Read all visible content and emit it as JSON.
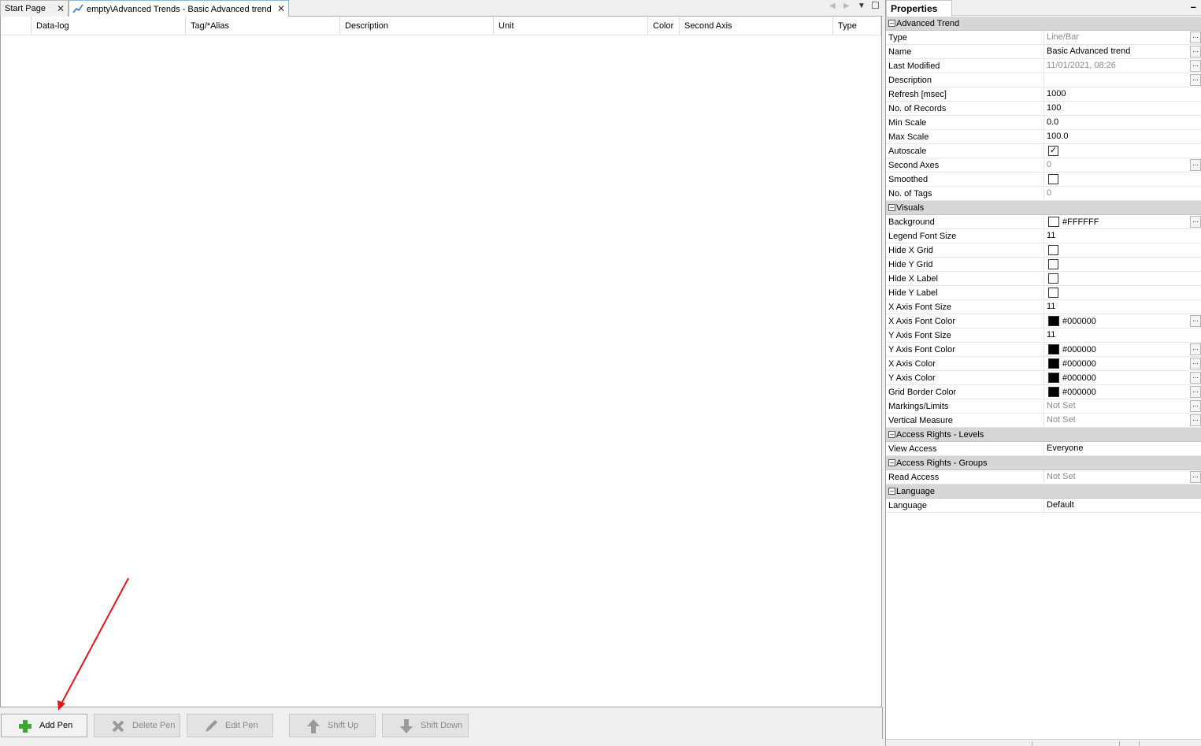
{
  "tabs": [
    {
      "label": "Start Page"
    },
    {
      "label": "empty\\Advanced Trends - Basic Advanced trend"
    }
  ],
  "grid": {
    "columns": [
      "Data-log",
      "Tag/*Alias",
      "Description",
      "Unit",
      "Color",
      "Second Axis",
      "Type"
    ]
  },
  "buttons": {
    "add_pen": "Add Pen",
    "delete_pen": "Delete Pen",
    "edit_pen": "Edit Pen",
    "shift_up": "Shift Up",
    "shift_down": "Shift Down"
  },
  "props": {
    "title": "Properties",
    "sections": {
      "advanced_trend": "Advanced Trend",
      "visuals": "Visuals",
      "access_levels": "Access Rights - Levels",
      "access_groups": "Access Rights - Groups",
      "language": "Language"
    },
    "rows": {
      "type": {
        "name": "Type",
        "value": "Line/Bar"
      },
      "name": {
        "name": "Name",
        "value": "Basic Advanced trend"
      },
      "last_modified": {
        "name": "Last Modified",
        "value": "11/01/2021, 08:26"
      },
      "description": {
        "name": "Description",
        "value": ""
      },
      "refresh": {
        "name": "Refresh [msec]",
        "value": "1000"
      },
      "records": {
        "name": "No. of Records",
        "value": "100"
      },
      "min_scale": {
        "name": "Min Scale",
        "value": "0.0"
      },
      "max_scale": {
        "name": "Max Scale",
        "value": "100.0"
      },
      "autoscale": {
        "name": "Autoscale",
        "checked": true
      },
      "second_axes": {
        "name": "Second Axes",
        "value": "0"
      },
      "smoothed": {
        "name": "Smoothed",
        "checked": false
      },
      "num_tags": {
        "name": "No. of Tags",
        "value": "0"
      },
      "background": {
        "name": "Background",
        "value": "#FFFFFF",
        "color": "#FFFFFF"
      },
      "legend_font": {
        "name": "Legend Font Size",
        "value": "11"
      },
      "hide_x_grid": {
        "name": "Hide X Grid",
        "checked": false
      },
      "hide_y_grid": {
        "name": "Hide Y Grid",
        "checked": false
      },
      "hide_x_label": {
        "name": "Hide X Label",
        "checked": false
      },
      "hide_y_label": {
        "name": "Hide Y Label",
        "checked": false
      },
      "x_font_size": {
        "name": "X Axis Font Size",
        "value": "11"
      },
      "x_font_color": {
        "name": "X Axis Font Color",
        "value": "#000000",
        "color": "#000000"
      },
      "y_font_size": {
        "name": "Y Axis Font Size",
        "value": "11"
      },
      "y_font_color": {
        "name": "Y Axis Font Color",
        "value": "#000000",
        "color": "#000000"
      },
      "x_color": {
        "name": "X Axis Color",
        "value": "#000000",
        "color": "#000000"
      },
      "y_color": {
        "name": "Y Axis Color",
        "value": "#000000",
        "color": "#000000"
      },
      "grid_border": {
        "name": "Grid Border Color",
        "value": "#000000",
        "color": "#000000"
      },
      "markings": {
        "name": "Markings/Limits",
        "value": "Not Set"
      },
      "vertical_measure": {
        "name": "Vertical Measure",
        "value": "Not Set"
      },
      "view_access": {
        "name": "View Access",
        "value": "Everyone"
      },
      "read_access": {
        "name": "Read Access",
        "value": "Not Set"
      },
      "language": {
        "name": "Language",
        "value": "Default"
      }
    }
  },
  "colors": {
    "annotation_arrow": "#e8141c",
    "add_icon": "#3aa832",
    "disabled_icon": "#9a9a9a",
    "section_bg": "#d6d6d6"
  }
}
